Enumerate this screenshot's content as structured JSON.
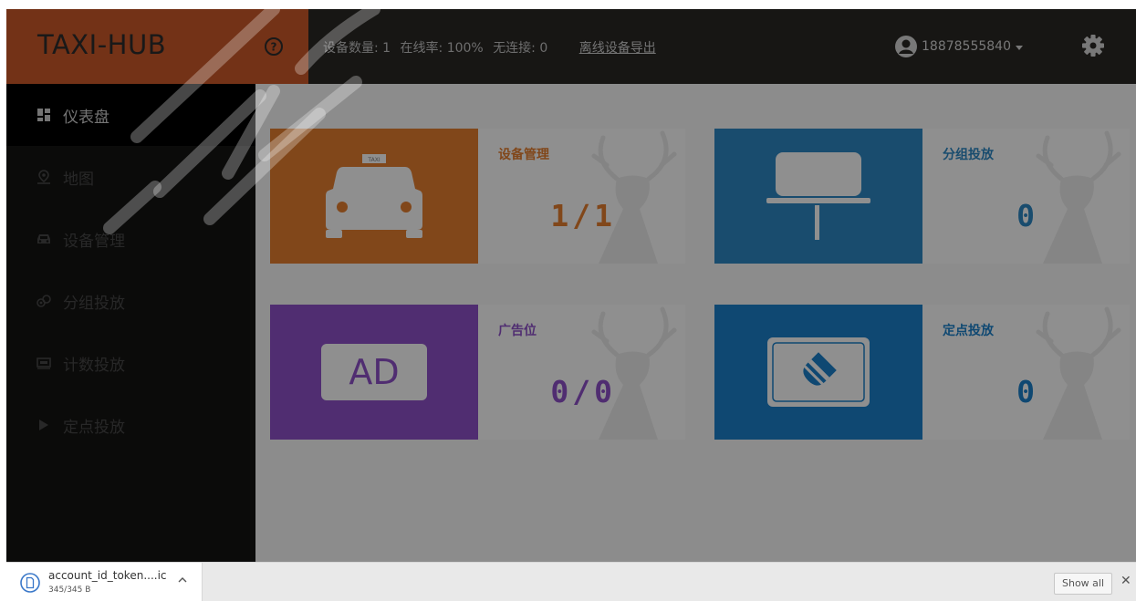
{
  "header": {
    "brand": "TAXI-HUB",
    "stats": {
      "device_count": "设备数量: 1",
      "online_rate": "在线率: 100%",
      "no_connection": "无连接: 0",
      "export_link": "离线设备导出"
    },
    "user": "18878555840",
    "icons": {
      "help": "help-circle-icon",
      "user": "user-avatar-icon",
      "settings": "gear-icon"
    }
  },
  "sidebar": {
    "items": [
      {
        "label": "仪表盘",
        "icon": "dashboard-icon",
        "active": true
      },
      {
        "label": "地图",
        "icon": "map-pin-icon",
        "active": false
      },
      {
        "label": "设备管理",
        "icon": "car-icon",
        "active": false
      },
      {
        "label": "分组投放",
        "icon": "group-icon",
        "active": false
      },
      {
        "label": "计数投放",
        "icon": "counter-icon",
        "active": false
      },
      {
        "label": "定点投放",
        "icon": "play-icon",
        "active": false
      }
    ]
  },
  "cards": [
    {
      "title": "设备管理",
      "value": "1/1",
      "color": "#de7a2e",
      "icon": "taxi-icon",
      "icon_text": "TAXI"
    },
    {
      "title": "分组投放",
      "value": "0",
      "color": "#2b84be",
      "icon": "billboard-icon"
    },
    {
      "title": "广告位",
      "value": "0/0",
      "color": "#8a4fc3",
      "icon": "ad-icon",
      "icon_text": "AD"
    },
    {
      "title": "定点投放",
      "value": "0",
      "color": "#1b7dc4",
      "icon": "location-tag-icon"
    }
  ],
  "download_bar": {
    "file_name": "account_id_token....ic",
    "file_size": "345/345 B",
    "show_all": "Show all",
    "close": "✕"
  },
  "colors": {
    "brand_bg": "#c65628",
    "topbar_bg": "#282624",
    "sidebar_bg": "#141312"
  }
}
